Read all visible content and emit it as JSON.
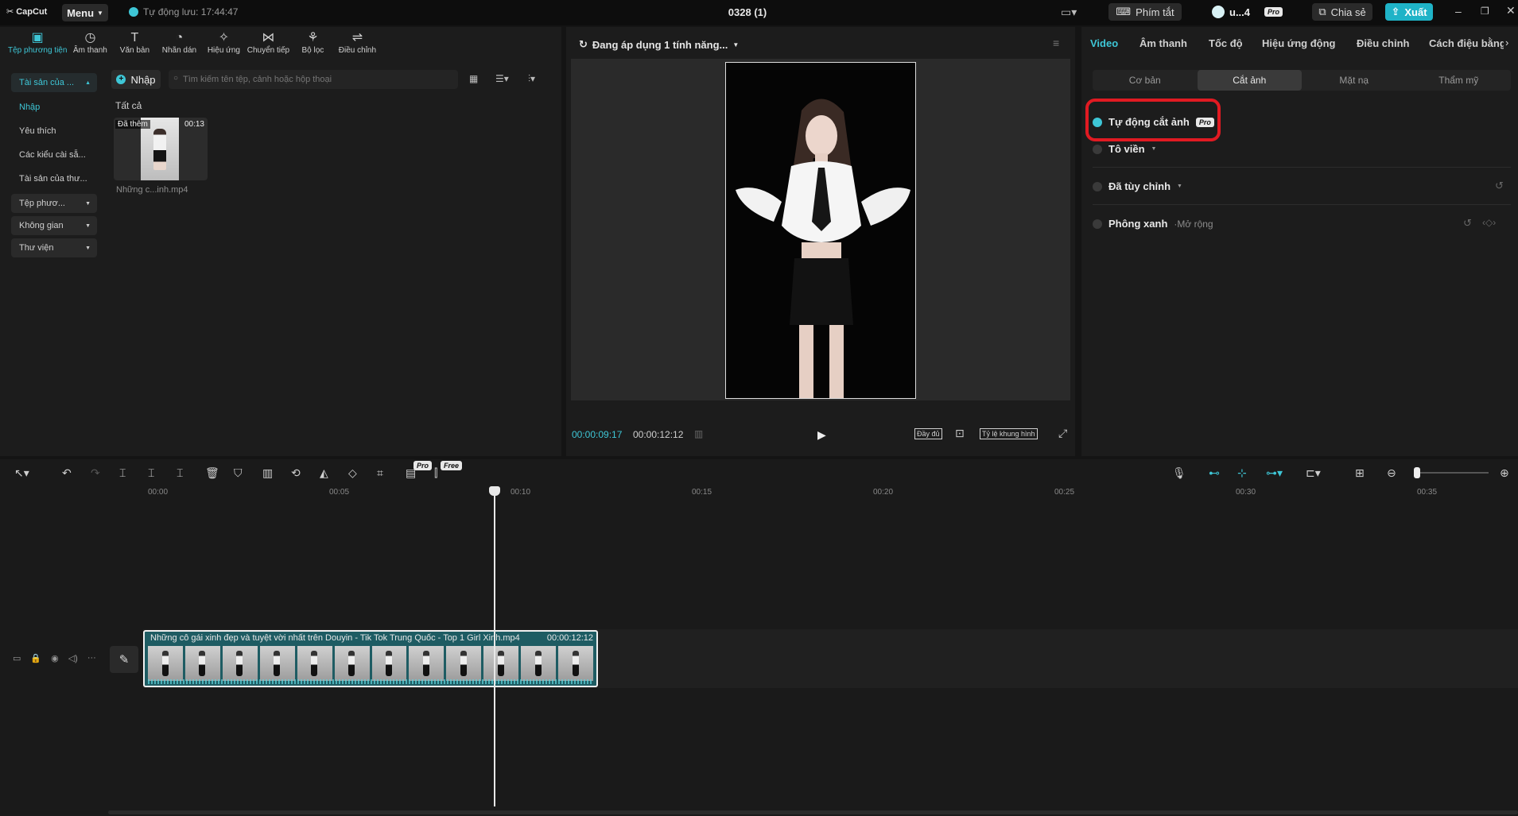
{
  "titlebar": {
    "logo": "CapCut",
    "menu": "Menu",
    "autosave": "Tự động lưu: 17:44:47",
    "project_title": "0328 (1)",
    "shortcuts": "Phím tắt",
    "user": "u...4",
    "pro": "Pro",
    "share": "Chia sẻ",
    "export": "Xuất"
  },
  "tools": [
    {
      "label": "Tệp phương tiện",
      "icon": "media-icon"
    },
    {
      "label": "Âm thanh",
      "icon": "audio-icon"
    },
    {
      "label": "Văn bản",
      "icon": "text-icon"
    },
    {
      "label": "Nhãn dán",
      "icon": "sticker-icon"
    },
    {
      "label": "Hiệu ứng",
      "icon": "effects-icon"
    },
    {
      "label": "Chuyển tiếp",
      "icon": "transition-icon"
    },
    {
      "label": "Bộ lọc",
      "icon": "filter-icon"
    },
    {
      "label": "Điều chỉnh",
      "icon": "adjust-icon"
    }
  ],
  "sidebar": {
    "assets": "Tài sản của ...",
    "import": "Nhập",
    "favorites": "Yêu thích",
    "presets": "Các kiểu cài sẵ...",
    "library_assets": "Tài sản của thư...",
    "media_file": "Tệp phươ...",
    "space": "Không gian",
    "library": "Thư viện"
  },
  "media": {
    "import_button": "Nhập",
    "search_placeholder": "Tìm kiếm tên tệp, cảnh hoặc hộp thoại",
    "all_label": "Tất cả",
    "item_added": "Đã thêm",
    "item_duration": "00:13",
    "item_name": "Những c...inh.mp4"
  },
  "preview": {
    "status": "Đang áp dụng 1 tính năng...",
    "time_current": "00:00:09:17",
    "time_total": "00:00:12:12",
    "full": "Đầy đủ",
    "ratio": "Tỷ lệ khung hình"
  },
  "right_tabs": [
    "Video",
    "Âm thanh",
    "Tốc độ",
    "Hiệu ứng động",
    "Điều chỉnh",
    "Cách điệu bằng"
  ],
  "sub_tabs": [
    "Cơ bản",
    "Cắt ảnh",
    "Mặt nạ",
    "Thẩm mỹ"
  ],
  "options": {
    "auto_cutout": "Tự động cắt ảnh",
    "auto_cutout_badge": "Pro",
    "stroke": "Tô viền",
    "custom": "Đã tùy chỉnh",
    "chroma": "Phông xanh",
    "chroma_note": "Mở rộng"
  },
  "toolbar_badges": {
    "pro": "Pro",
    "free": "Free"
  },
  "ruler": [
    "00:00",
    "00:05",
    "00:10",
    "00:15",
    "00:20",
    "00:25",
    "00:30",
    "00:35"
  ],
  "clip": {
    "label": "Những cô gái xinh đẹp và tuyệt vời nhất trên Douyin - Tik Tok Trung Quốc - Top 1 Girl Xinh.mp4",
    "duration": "00:00:12:12"
  },
  "colors": {
    "accent": "#3ec6d6",
    "highlight_box": "#e11a22",
    "export": "#1fb3c7"
  }
}
